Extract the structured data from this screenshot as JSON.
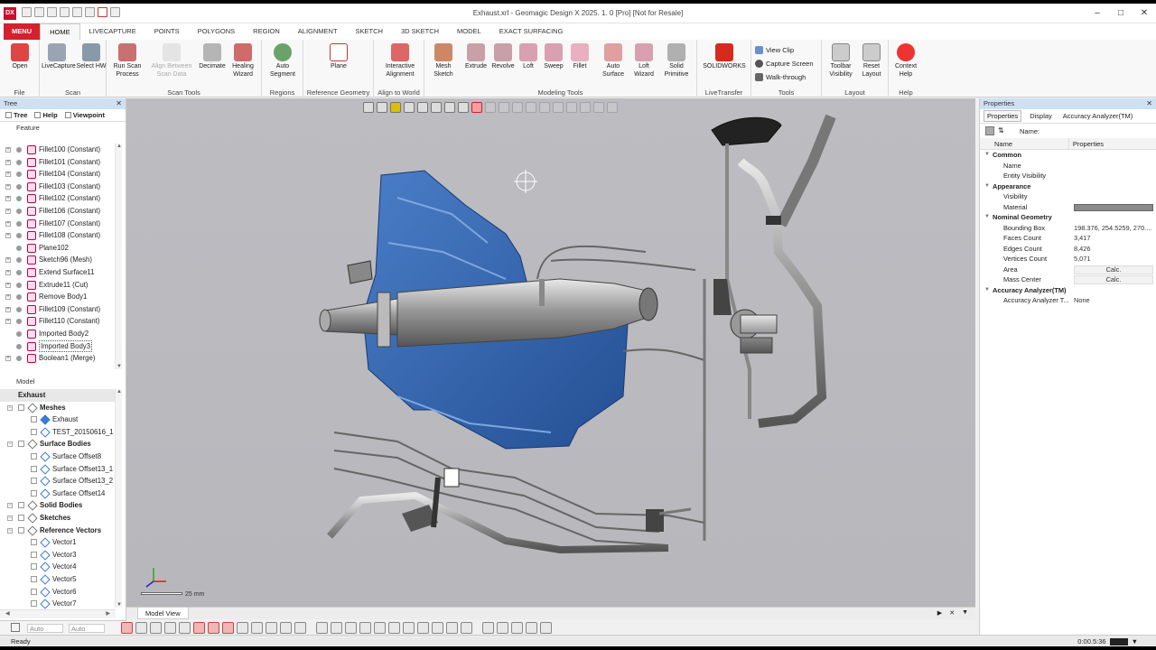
{
  "window": {
    "title": "Exhaust.xrl - Geomagic Design X 2025. 1. 0 [Pro] [Not for Resale]",
    "logo": "DX"
  },
  "tabs": [
    "MENU",
    "HOME",
    "LIVECAPTURE",
    "POINTS",
    "POLYGONS",
    "REGION",
    "ALIGNMENT",
    "SKETCH",
    "3D SKETCH",
    "MODEL",
    "EXACT SURFACING"
  ],
  "ribbon": {
    "groups": {
      "file": "File",
      "scan": "Scan",
      "scan_tools": "Scan Tools",
      "regions": "Regions",
      "reference_geometry": "Reference Geometry",
      "align_to_world": "Align to World",
      "modeling_tools": "Modeling Tools",
      "livetransfer": "LiveTransfer",
      "tools": "Tools",
      "layout": "Layout",
      "help": "Help"
    },
    "buttons": {
      "open": "Open",
      "livecapture": "LiveCapture",
      "select_hw": "Select HW",
      "run_scan_process": "Run Scan Process",
      "align_between_scan_data": "Align Between Scan Data",
      "decimate": "Decimate",
      "healing_wizard": "Healing Wizard",
      "auto_segment": "Auto Segment",
      "plane": "Plane",
      "interactive_alignment": "Interactive Alignment",
      "mesh_sketch": "Mesh Sketch",
      "extrude": "Extrude",
      "revolve": "Revolve",
      "loft": "Loft",
      "sweep": "Sweep",
      "fillet": "Fillet",
      "auto_surface": "Auto Surface",
      "loft_wizard": "Loft Wizard",
      "solid_primitive": "Solid Primitive",
      "solidworks": "SOLIDWORKS",
      "view_clip": "View Clip",
      "capture_screen": "Capture Screen",
      "walk_through": "Walk-through",
      "toolbar_visibility": "Toolbar Visibility",
      "reset_layout": "Reset Layout",
      "context_help": "Context Help"
    }
  },
  "tree_panel": {
    "title": "Tree",
    "subtabs": [
      "Tree",
      "Help",
      "Viewpoint"
    ],
    "section": "Feature",
    "items": [
      "Fillet100 (Constant)",
      "Fillet101 (Constant)",
      "Fillet104 (Constant)",
      "Fillet103 (Constant)",
      "Fillet102 (Constant)",
      "Fillet106 (Constant)",
      "Fillet107 (Constant)",
      "Fillet108 (Constant)",
      "Plane102",
      "Sketch96 (Mesh)",
      "Extend Surface11",
      "Extrude11 (Cut)",
      "Remove Body1",
      "Fillet109 (Constant)",
      "Fillet110 (Constant)",
      "Imported Body2",
      "Imported Body3",
      "Boolean1 (Merge)"
    ],
    "model_label": "Model",
    "model_root": "Exhaust",
    "model_items": [
      "Meshes",
      "Exhaust",
      "TEST_20150616_1",
      "Surface Bodies",
      "Surface Offset8",
      "Surface Offset13_1",
      "Surface Offset13_2",
      "Surface Offset14",
      "Solid Bodies",
      "Sketches",
      "Reference Vectors",
      "Vector1",
      "Vector3",
      "Vector4",
      "Vector5",
      "Vector6",
      "Vector7"
    ],
    "bottom_fields": [
      "Auto",
      "Auto"
    ]
  },
  "viewport": {
    "scale_label": "25 mm",
    "tab_label": "Model View"
  },
  "properties": {
    "title": "Properties",
    "tabs": [
      "Properties",
      "Display",
      "Accuracy Analyzer(TM)"
    ],
    "name_filter": "Name:",
    "columns": [
      "Name",
      "Properties"
    ],
    "rows": {
      "common": "Common",
      "name": "Name",
      "entity_visibility": "Entity Visibility",
      "appearance": "Appearance",
      "visibility": "Visibility",
      "material": "Material",
      "nominal_geometry": "Nominal Geometry",
      "bounding_box": "Bounding Box",
      "bounding_box_value": "198.376, 254.5259, 270....",
      "faces_count": "Faces Count",
      "faces_count_value": "3,417",
      "edges_count": "Edges Count",
      "edges_count_value": "8,426",
      "vertices_count": "Vertices Count",
      "vertices_count_value": "5,071",
      "area": "Area",
      "calc": "Calc.",
      "mass_center": "Mass Center",
      "accuracy_analyzer": "Accuracy Analyzer(TM)",
      "accuracy_analyzer_t": "Accuracy Analyzer T...",
      "none": "None"
    }
  },
  "status": {
    "ready": "Ready",
    "time": "0:00.5:36"
  },
  "colors": {
    "menu_red": "#d5202e",
    "panel_header": "#cfe0f3",
    "viewport_bg": "#bcbcc1",
    "model_blue": "#3b6db5"
  }
}
